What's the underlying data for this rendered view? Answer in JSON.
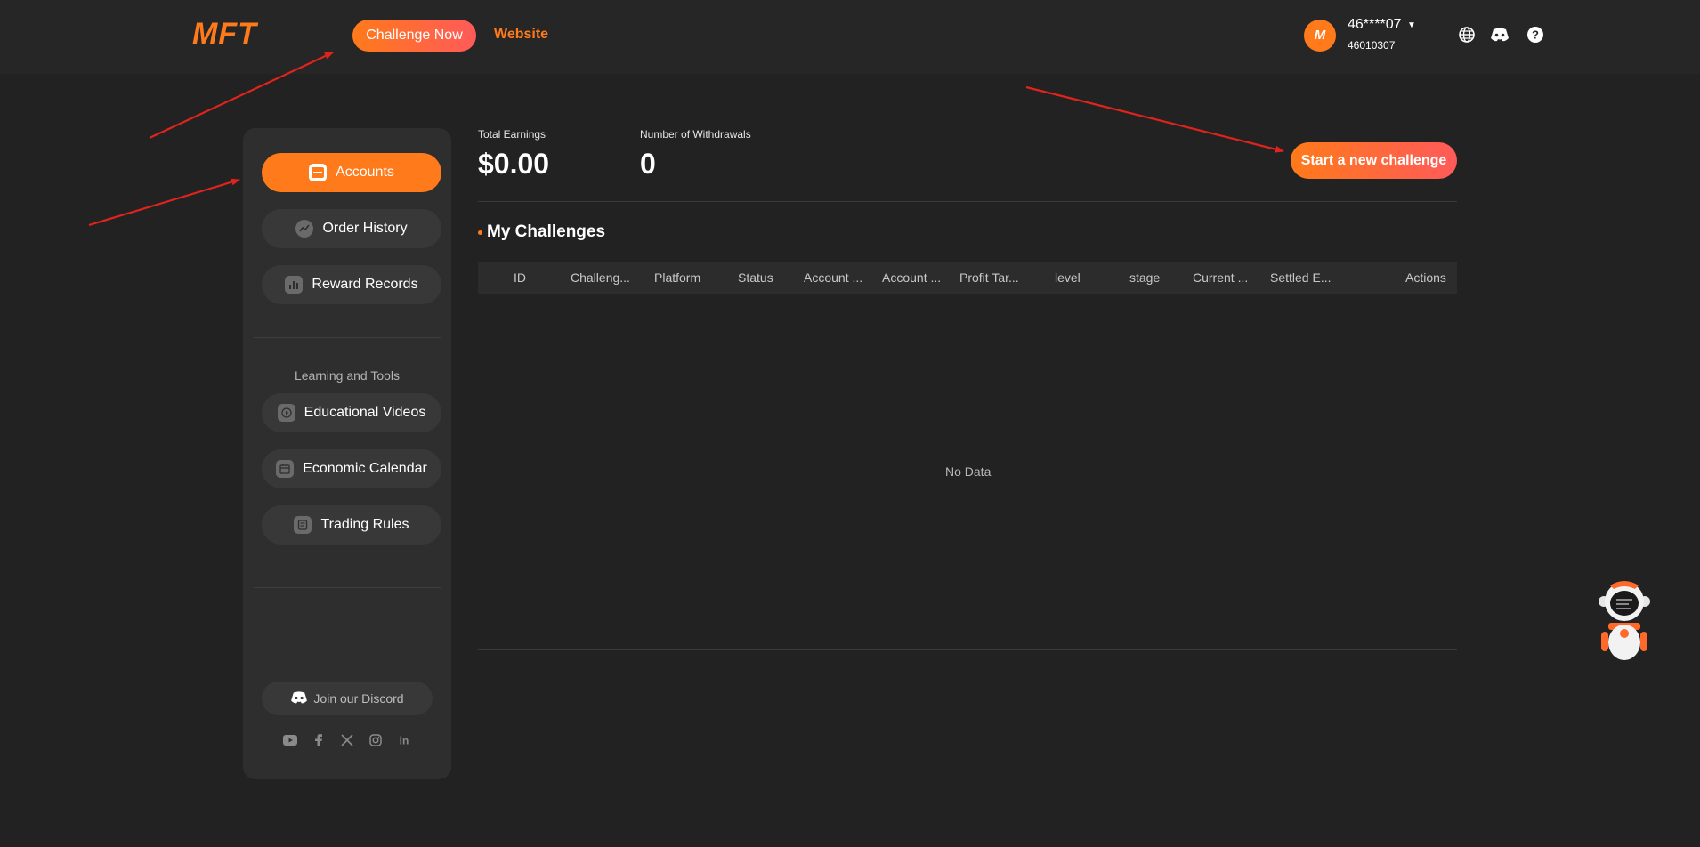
{
  "header": {
    "logo": "MFT",
    "challenge_now_label": "Challenge Now",
    "website_label": "Website",
    "avatar_letter": "M",
    "user_name": "46****07",
    "user_id": "46010307",
    "icons": [
      "globe-icon",
      "discord-icon",
      "help-icon"
    ]
  },
  "sidebar": {
    "items": [
      {
        "label": "Accounts",
        "icon": "wallet-icon",
        "active": true
      },
      {
        "label": "Order History",
        "icon": "trend-icon"
      },
      {
        "label": "Reward Records",
        "icon": "bar-chart-icon"
      }
    ],
    "section_label": "Learning and Tools",
    "tools": [
      {
        "label": "Educational Videos",
        "icon": "play-icon"
      },
      {
        "label": "Economic Calendar",
        "icon": "calendar-icon"
      },
      {
        "label": "Trading Rules",
        "icon": "rules-icon"
      }
    ],
    "discord_label": "Join our Discord",
    "socials": [
      "youtube-icon",
      "facebook-icon",
      "x-icon",
      "instagram-icon",
      "linkedin-icon"
    ]
  },
  "main": {
    "total_earnings_label": "Total Earnings",
    "total_earnings_value": "$0.00",
    "withdrawals_label": "Number of Withdrawals",
    "withdrawals_value": "0",
    "start_button_label": "Start a new challenge",
    "section_title": "My Challenges",
    "table_columns": [
      "ID",
      "Challeng...",
      "Platform",
      "Status",
      "Account ...",
      "Account ...",
      "Profit Tar...",
      "level",
      "stage",
      "Current ...",
      "Settled E...",
      "Actions"
    ],
    "empty_text": "No Data"
  },
  "colors": {
    "accent": "#ff7a1a",
    "accent_gradient_end": "#ff5a5a",
    "background": "#222222",
    "panel": "#2e2e2e",
    "annotation_arrow": "#e0231c"
  }
}
